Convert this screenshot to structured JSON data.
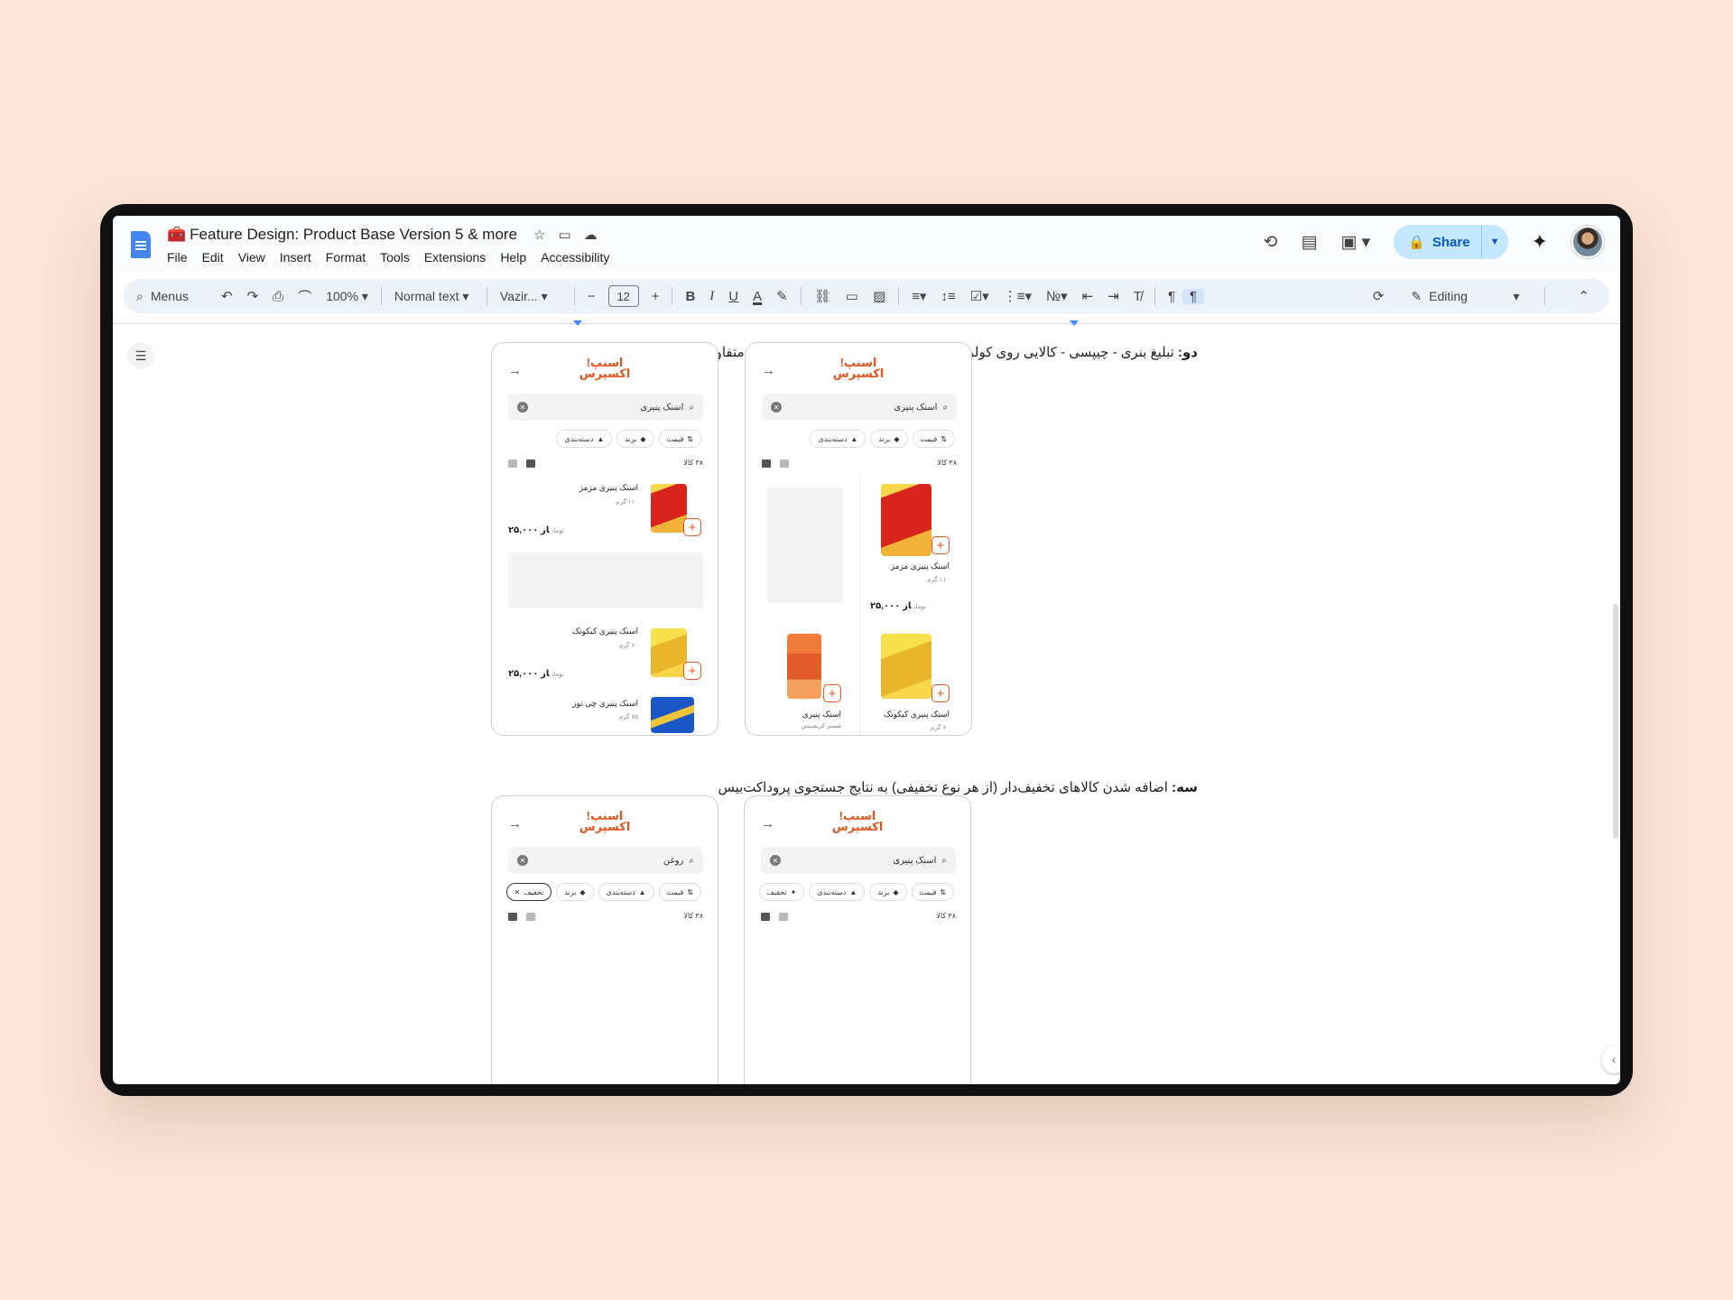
{
  "doc": {
    "title": "Feature Design: Product Base Version 5 & more",
    "title_emoji": "🧰",
    "menu": [
      "File",
      "Edit",
      "View",
      "Insert",
      "Format",
      "Tools",
      "Extensions",
      "Help",
      "Accessibility"
    ]
  },
  "header": {
    "share_label": "Share"
  },
  "toolbar": {
    "menus_label": "Menus",
    "zoom": "100%",
    "style": "Normal text",
    "font": "Vazir...",
    "font_size": "12",
    "mode": "Editing"
  },
  "content": {
    "section2": {
      "lead": "دو:",
      "text": " تبلیغ بنری - چیپسی -  کالایی روی کولرهای متفاوت متناسب با حوزه جغرافیایی متفاوت"
    },
    "section3": {
      "lead": "سه:",
      "text": " اضافه شدن کالاهای تخفیف‌دار (از هر نوع تخفیفی) به نتایج جستجوی پروداکت‌بیس"
    }
  },
  "app": {
    "logo_line1": "اسنپ!",
    "logo_line2": "اکسپرس",
    "chip_price": "قیمت",
    "chip_brand": "برند",
    "chip_category": "دسته‌بندی",
    "chip_discount": "تخفیف",
    "count": "۳۸ کالا",
    "currency": "تومان"
  },
  "phones": {
    "p1": {
      "query": "اسنک پنیری",
      "items": [
        {
          "name": "اسنک پنیری مزمز",
          "weight": "۱۱۰ گرم",
          "price": "از ۲۵,۰۰۰"
        },
        {
          "name": "اسنک پنیری کیکوتک",
          "weight": "۶۰ گرم",
          "price": "از ۲۵,۰۰۰"
        },
        {
          "name": "اسنک پنیری چی توز",
          "weight": "۷۵ گرم"
        }
      ]
    },
    "p2": {
      "query": "اسنک پنیری",
      "items": [
        {
          "name": "اسنک پنیری مزمز",
          "weight": "۱۱۰ گرم",
          "price": "از ۲۵,۰۰۰"
        },
        {
          "name": "اسنک پنیری کیکوتک",
          "weight": "۶۰ گرم"
        },
        {
          "name": "اسنک پنیری",
          "name2": "مستر کریسپس"
        }
      ]
    },
    "p3": {
      "query": "روغن"
    },
    "p4": {
      "query": "اسنک پنیری"
    }
  }
}
